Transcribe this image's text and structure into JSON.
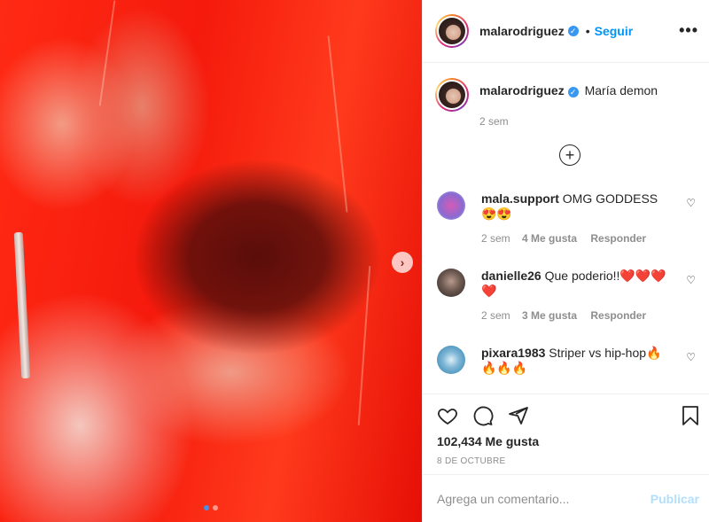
{
  "post": {
    "author": "malarodriguez",
    "follow_label": "Seguir",
    "more_label": "•••",
    "bullet": "•",
    "caption_text": "María demon",
    "caption_time": "2 sem",
    "carousel": {
      "slides": 2,
      "active": 1,
      "next_label": "›"
    },
    "verified_mark": "✓"
  },
  "comments": [
    {
      "user": "mala.support",
      "text": "OMG GODDESS 😍😍",
      "time": "2 sem",
      "likes": "4 Me gusta",
      "reply": "Responder",
      "avatar_color": "#8a6ad0"
    },
    {
      "user": "danielle26",
      "text": "Que poderio!!❤️❤️❤️❤️",
      "time": "2 sem",
      "likes": "3 Me gusta",
      "reply": "Responder",
      "avatar_color": "#5a4a44"
    },
    {
      "user": "pixara1983",
      "text": "Striper vs hip-hop🔥🔥🔥🔥",
      "avatar_color": "#2f7fb0"
    }
  ],
  "actions": {
    "likes_count": "102,434 Me gusta",
    "date": "8 DE OCTUBRE",
    "icons": [
      "heart-icon",
      "comment-icon",
      "share-icon",
      "bookmark-icon"
    ]
  },
  "composer": {
    "placeholder": "Agrega un comentario...",
    "publish_label": "Publicar"
  },
  "colors": {
    "accent": "#0095f6",
    "publish_disabled": "#b2dffc",
    "verified": "#3897f0",
    "muted": "#8e8e8e"
  }
}
